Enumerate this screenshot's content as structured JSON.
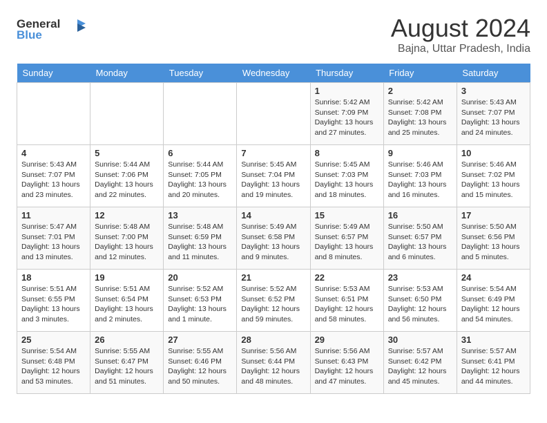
{
  "header": {
    "logo_line1": "General",
    "logo_line2": "Blue",
    "month": "August 2024",
    "location": "Bajna, Uttar Pradesh, India"
  },
  "weekdays": [
    "Sunday",
    "Monday",
    "Tuesday",
    "Wednesday",
    "Thursday",
    "Friday",
    "Saturday"
  ],
  "weeks": [
    [
      {
        "day": "",
        "info": ""
      },
      {
        "day": "",
        "info": ""
      },
      {
        "day": "",
        "info": ""
      },
      {
        "day": "",
        "info": ""
      },
      {
        "day": "1",
        "info": "Sunrise: 5:42 AM\nSunset: 7:09 PM\nDaylight: 13 hours\nand 27 minutes."
      },
      {
        "day": "2",
        "info": "Sunrise: 5:42 AM\nSunset: 7:08 PM\nDaylight: 13 hours\nand 25 minutes."
      },
      {
        "day": "3",
        "info": "Sunrise: 5:43 AM\nSunset: 7:07 PM\nDaylight: 13 hours\nand 24 minutes."
      }
    ],
    [
      {
        "day": "4",
        "info": "Sunrise: 5:43 AM\nSunset: 7:07 PM\nDaylight: 13 hours\nand 23 minutes."
      },
      {
        "day": "5",
        "info": "Sunrise: 5:44 AM\nSunset: 7:06 PM\nDaylight: 13 hours\nand 22 minutes."
      },
      {
        "day": "6",
        "info": "Sunrise: 5:44 AM\nSunset: 7:05 PM\nDaylight: 13 hours\nand 20 minutes."
      },
      {
        "day": "7",
        "info": "Sunrise: 5:45 AM\nSunset: 7:04 PM\nDaylight: 13 hours\nand 19 minutes."
      },
      {
        "day": "8",
        "info": "Sunrise: 5:45 AM\nSunset: 7:03 PM\nDaylight: 13 hours\nand 18 minutes."
      },
      {
        "day": "9",
        "info": "Sunrise: 5:46 AM\nSunset: 7:03 PM\nDaylight: 13 hours\nand 16 minutes."
      },
      {
        "day": "10",
        "info": "Sunrise: 5:46 AM\nSunset: 7:02 PM\nDaylight: 13 hours\nand 15 minutes."
      }
    ],
    [
      {
        "day": "11",
        "info": "Sunrise: 5:47 AM\nSunset: 7:01 PM\nDaylight: 13 hours\nand 13 minutes."
      },
      {
        "day": "12",
        "info": "Sunrise: 5:48 AM\nSunset: 7:00 PM\nDaylight: 13 hours\nand 12 minutes."
      },
      {
        "day": "13",
        "info": "Sunrise: 5:48 AM\nSunset: 6:59 PM\nDaylight: 13 hours\nand 11 minutes."
      },
      {
        "day": "14",
        "info": "Sunrise: 5:49 AM\nSunset: 6:58 PM\nDaylight: 13 hours\nand 9 minutes."
      },
      {
        "day": "15",
        "info": "Sunrise: 5:49 AM\nSunset: 6:57 PM\nDaylight: 13 hours\nand 8 minutes."
      },
      {
        "day": "16",
        "info": "Sunrise: 5:50 AM\nSunset: 6:57 PM\nDaylight: 13 hours\nand 6 minutes."
      },
      {
        "day": "17",
        "info": "Sunrise: 5:50 AM\nSunset: 6:56 PM\nDaylight: 13 hours\nand 5 minutes."
      }
    ],
    [
      {
        "day": "18",
        "info": "Sunrise: 5:51 AM\nSunset: 6:55 PM\nDaylight: 13 hours\nand 3 minutes."
      },
      {
        "day": "19",
        "info": "Sunrise: 5:51 AM\nSunset: 6:54 PM\nDaylight: 13 hours\nand 2 minutes."
      },
      {
        "day": "20",
        "info": "Sunrise: 5:52 AM\nSunset: 6:53 PM\nDaylight: 13 hours\nand 1 minute."
      },
      {
        "day": "21",
        "info": "Sunrise: 5:52 AM\nSunset: 6:52 PM\nDaylight: 12 hours\nand 59 minutes."
      },
      {
        "day": "22",
        "info": "Sunrise: 5:53 AM\nSunset: 6:51 PM\nDaylight: 12 hours\nand 58 minutes."
      },
      {
        "day": "23",
        "info": "Sunrise: 5:53 AM\nSunset: 6:50 PM\nDaylight: 12 hours\nand 56 minutes."
      },
      {
        "day": "24",
        "info": "Sunrise: 5:54 AM\nSunset: 6:49 PM\nDaylight: 12 hours\nand 54 minutes."
      }
    ],
    [
      {
        "day": "25",
        "info": "Sunrise: 5:54 AM\nSunset: 6:48 PM\nDaylight: 12 hours\nand 53 minutes."
      },
      {
        "day": "26",
        "info": "Sunrise: 5:55 AM\nSunset: 6:47 PM\nDaylight: 12 hours\nand 51 minutes."
      },
      {
        "day": "27",
        "info": "Sunrise: 5:55 AM\nSunset: 6:46 PM\nDaylight: 12 hours\nand 50 minutes."
      },
      {
        "day": "28",
        "info": "Sunrise: 5:56 AM\nSunset: 6:44 PM\nDaylight: 12 hours\nand 48 minutes."
      },
      {
        "day": "29",
        "info": "Sunrise: 5:56 AM\nSunset: 6:43 PM\nDaylight: 12 hours\nand 47 minutes."
      },
      {
        "day": "30",
        "info": "Sunrise: 5:57 AM\nSunset: 6:42 PM\nDaylight: 12 hours\nand 45 minutes."
      },
      {
        "day": "31",
        "info": "Sunrise: 5:57 AM\nSunset: 6:41 PM\nDaylight: 12 hours\nand 44 minutes."
      }
    ]
  ]
}
